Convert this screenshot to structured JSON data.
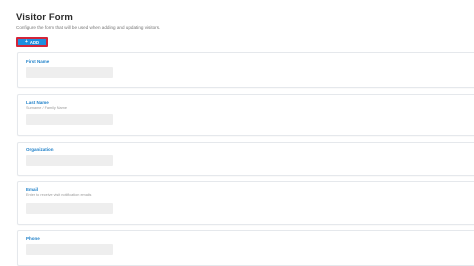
{
  "page": {
    "title": "Visitor Form",
    "subtitle": "Configure the form that will be used when adding and updating visitors."
  },
  "toolbar": {
    "add_label": "ADD",
    "add_icon": "plus-icon"
  },
  "fields": [
    {
      "label": "First Name",
      "hint": "",
      "value": ""
    },
    {
      "label": "Last Name",
      "hint": "Surname / Family Name",
      "value": ""
    },
    {
      "label": "Organization",
      "hint": "",
      "value": ""
    },
    {
      "label": "Email",
      "hint": "Enter to receive visit notification emails",
      "value": ""
    },
    {
      "label": "Phone",
      "hint": "",
      "value": ""
    }
  ],
  "colors": {
    "accent": "#1d7fc8",
    "button": "#1c8fe0",
    "highlight_border": "#d2253a"
  }
}
